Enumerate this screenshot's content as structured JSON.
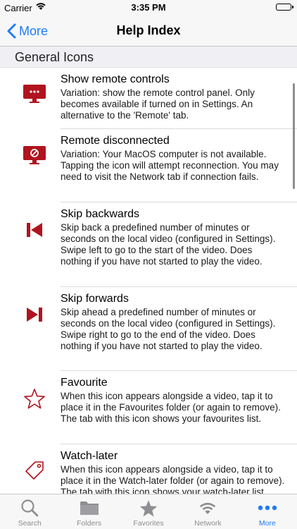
{
  "status_bar": {
    "carrier": "Carrier",
    "time": "3:35 PM"
  },
  "nav": {
    "back_label": "More",
    "title": "Help Index"
  },
  "section": {
    "title": "General Icons"
  },
  "items": [
    {
      "icon": "monitor-remote-icon",
      "title": "Show remote controls",
      "description": "Variation: show the remote control panel. Only becomes available if turned on in Settings. An alternative to the 'Remote' tab."
    },
    {
      "icon": "monitor-disconnected-icon",
      "title": "Remote disconnected",
      "description": "Variation: Your MacOS computer is not available. Tapping the icon will attempt reconnection. You may need to visit the Network tab if connection fails."
    },
    {
      "icon": "skip-backward-icon",
      "title": "Skip backwards",
      "description": "Skip back a predefined number of minutes or seconds on the local video (configured in Settings). Swipe left to go to the start of the video. Does nothing if you have not started to play the video."
    },
    {
      "icon": "skip-forward-icon",
      "title": "Skip forwards",
      "description": "Skip ahead a predefined number of minutes or seconds on the local video (configured in Settings). Swipe right to go to the end of the video. Does nothing if you have not started to play the video."
    },
    {
      "icon": "star-icon",
      "title": "Favourite",
      "description": "When this icon appears alongside a video, tap it to place it in the Favourites folder (or again to remove). The tab with this icon shows your favourites list."
    },
    {
      "icon": "tag-icon",
      "title": "Watch-later",
      "description": "When this icon appears alongside a video, tap it to place it in the Watch-later folder (or again to remove). The tab with this icon shows your watch-later list."
    }
  ],
  "tabs": [
    {
      "icon": "search-icon",
      "label": "Search"
    },
    {
      "icon": "folder-icon",
      "label": "Folders"
    },
    {
      "icon": "star-icon",
      "label": "Favorites"
    },
    {
      "icon": "wifi-icon",
      "label": "Network"
    },
    {
      "icon": "more-icon",
      "label": "More",
      "active": true
    }
  ],
  "colors": {
    "accent": "#1f7cf6",
    "icon_red": "#b0141e",
    "inactive_tab": "#8e8e93"
  }
}
